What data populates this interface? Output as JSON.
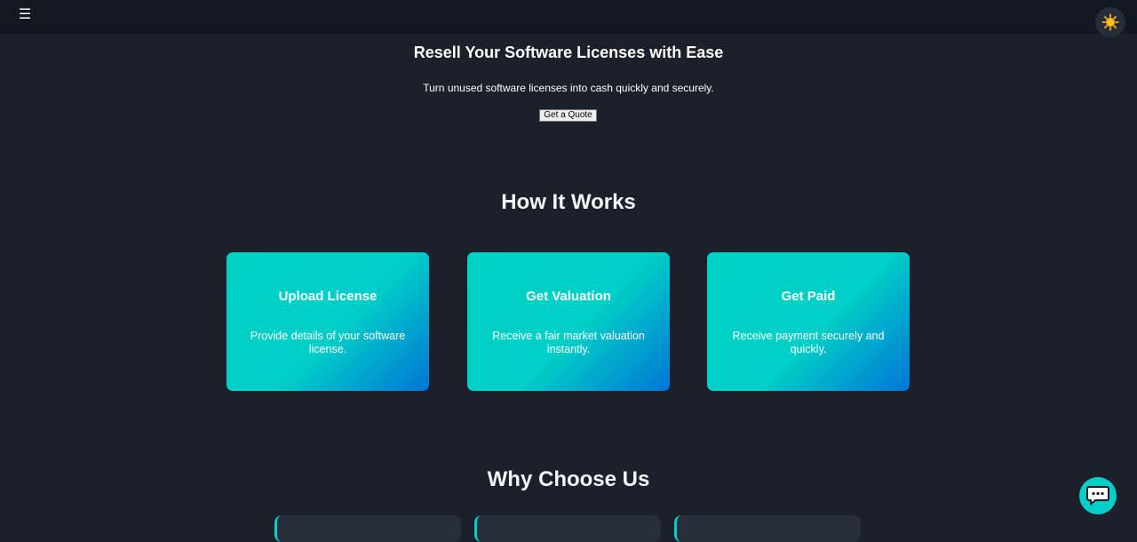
{
  "header": {
    "menu_icon": "hamburger-menu-icon",
    "menu_glyph": "☰",
    "theme_icon": "sun-icon"
  },
  "hero": {
    "title": "Resell Your Software Licenses with Ease",
    "subtitle": "Turn unused software licenses into cash quickly and securely.",
    "cta_label": "Get a Quote"
  },
  "how_it_works": {
    "title": "How It Works",
    "steps": [
      {
        "title": "Upload License",
        "description": "Provide details of your software license."
      },
      {
        "title": "Get Valuation",
        "description": "Receive a fair market valuation instantly."
      },
      {
        "title": "Get Paid",
        "description": "Receive payment securely and quickly."
      }
    ]
  },
  "why_choose_us": {
    "title": "Why Choose Us"
  },
  "chat": {
    "icon": "chat-bubble-icon"
  },
  "colors": {
    "background": "#1b202b",
    "topbar": "#131720",
    "accent": "#00cfc7",
    "accent_gradient_end": "#0075d6"
  }
}
